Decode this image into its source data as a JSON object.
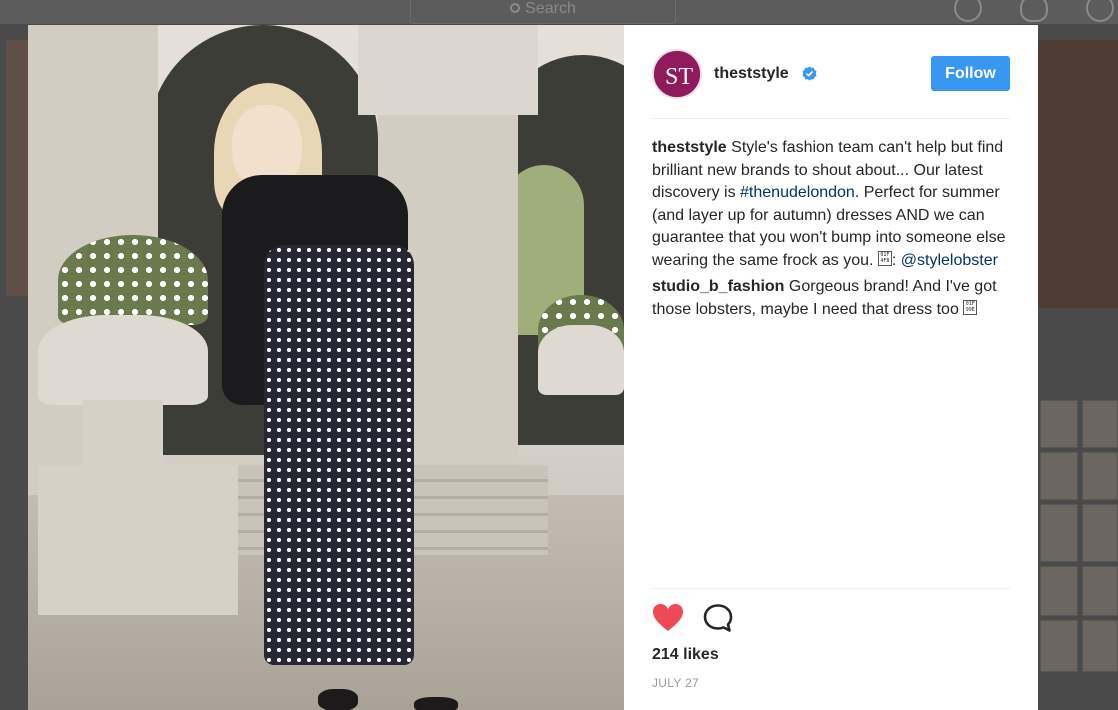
{
  "background": {
    "search_placeholder": "Search"
  },
  "post": {
    "account": {
      "username": "theststyle",
      "avatar_initials": "ST",
      "verified": true
    },
    "follow_label": "Follow",
    "caption": {
      "author": "theststyle",
      "text_parts": [
        {
          "type": "text",
          "value": "Style's fashion team can't help but find brilliant new brands to shout about... Our latest discovery is "
        },
        {
          "type": "hashtag",
          "value": "#thenudelondon"
        },
        {
          "type": "text",
          "value": ". Perfect for summer (and layer up for autumn) dresses AND we can guarantee that you won't bump into someone else wearing the same frock as you. "
        },
        {
          "type": "emoji",
          "value": "📸"
        },
        {
          "type": "text",
          "value": ": "
        },
        {
          "type": "mention",
          "value": "@stylelobster"
        }
      ]
    },
    "comments": [
      {
        "author": "studio_b_fashion",
        "text": "Gorgeous brand! And I've got those lobsters, maybe I need that dress too",
        "emoji": "🦞"
      }
    ],
    "liked": true,
    "likes_label": "214 likes",
    "date_label": "JULY 27",
    "colors": {
      "follow_button": "#3897f0",
      "heart": "#ed4956",
      "link": "#003569",
      "text": "#262626",
      "date": "#999999"
    },
    "icons": [
      "verified-badge-icon",
      "heart-icon",
      "comment-icon",
      "compass-icon",
      "activity-heart-icon",
      "profile-icon",
      "search-icon"
    ]
  }
}
